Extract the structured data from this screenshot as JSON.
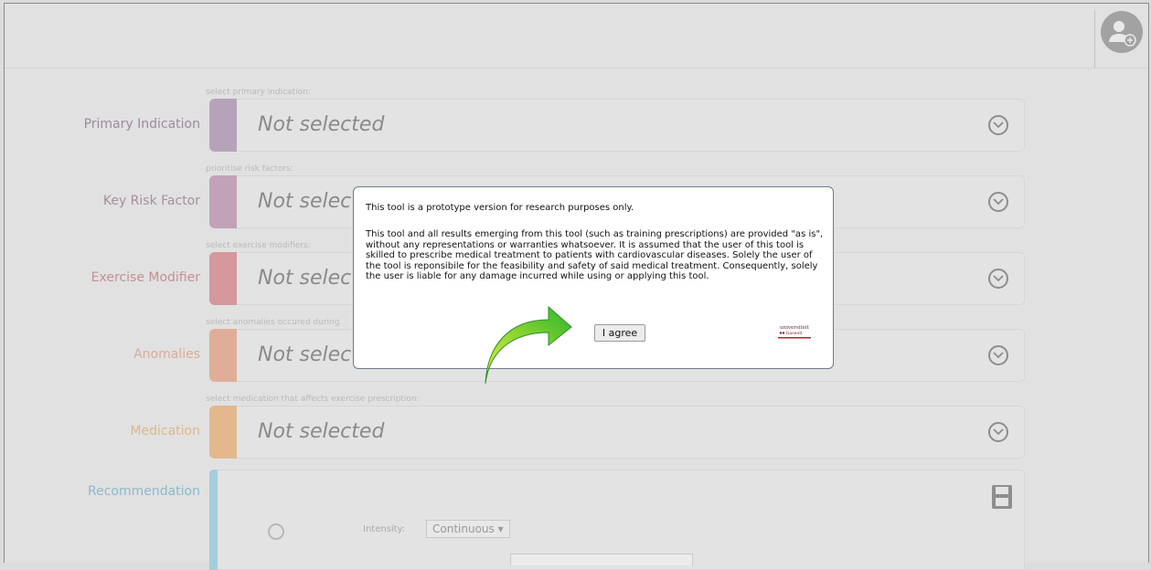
{
  "colors": {
    "primary": "#b9a5bd",
    "risk": "#c6a4bb",
    "modifier": "#d79a9d",
    "anomalies": "#e2b09a",
    "medication": "#e5bb8e",
    "recommendation": "#a4cee0"
  },
  "rows": [
    {
      "label": "Primary Indication",
      "hint": "select primary indication:",
      "value": "Not selected",
      "label_color": "#9b8a9f",
      "icon": "chevron-down-icon"
    },
    {
      "label": "Key Risk Factor",
      "hint": "prioritise risk factors:",
      "value": "Not selected",
      "label_color": "#a78e9f",
      "icon": "chevron-down-icon"
    },
    {
      "label": "Exercise Modifier",
      "hint": "select exercise modifiers:",
      "value": "Not selected",
      "label_color": "#c58f92",
      "icon": "chevron-down-icon"
    },
    {
      "label": "Anomalies",
      "hint": "select anomalies occured during",
      "value": "Not selected",
      "label_color": "#d9ab96",
      "icon": "chevron-down-icon"
    },
    {
      "label": "Medication",
      "hint": "select medication that affects exercise prescription:",
      "value": "Not selected",
      "label_color": "#dcb78e",
      "icon": "chevron-down-icon"
    }
  ],
  "recommendation": {
    "label": "Recommendation",
    "intensity_label": "Intensity:",
    "intensity_value": "Continuous",
    "save_icon": "floppy-disk-icon"
  },
  "modal": {
    "line1": "This tool is a prototype version for research purposes only.",
    "body": "This tool and all results emerging from this tool (such as training prescriptions) are provided \"as is\", without any representations or warranties whatsoever. It is assumed that the user of this tool is skilled to prescribe medical treatment to patients with cardiovascular diseases. Solely the user of the tool is reponsibile for the feasibility and safety of said medical treatment. Consequently, solely the user is liable for any damage incurred while using or applying this tool.",
    "agree_label": "I agree",
    "logo_text": "universiteit hasselt"
  },
  "header": {
    "user_icon": "user-add-icon"
  }
}
